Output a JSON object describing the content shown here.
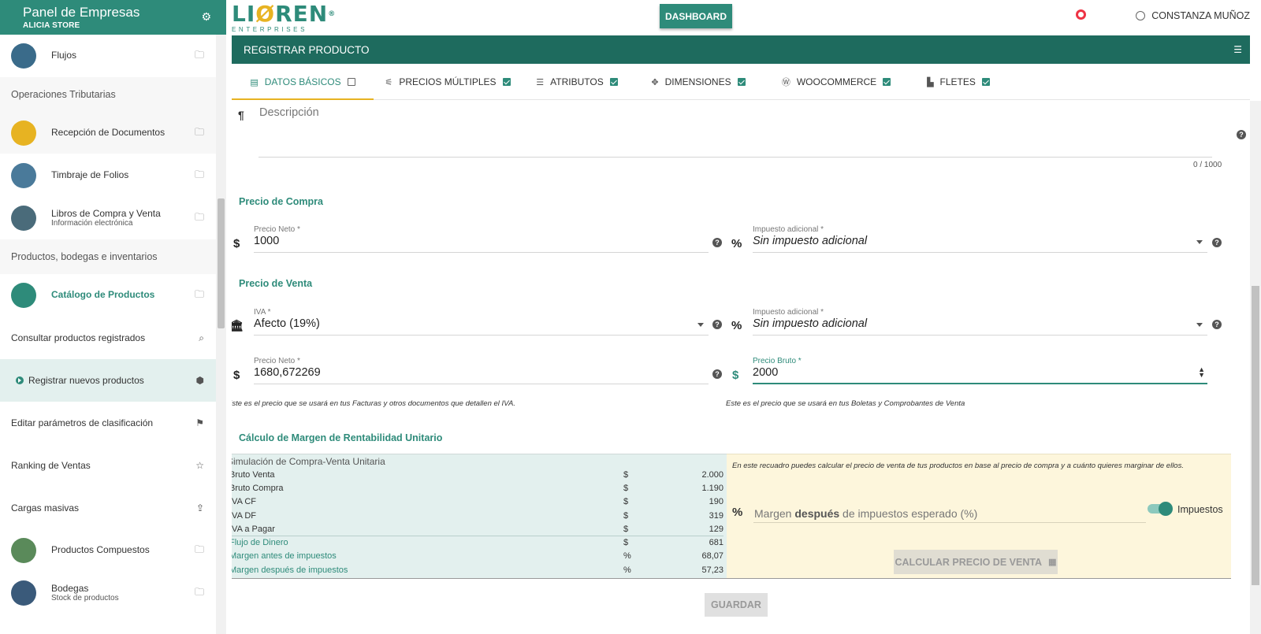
{
  "sidebar": {
    "title": "Panel de Empresas",
    "store": "ALICIA STORE",
    "items": [
      {
        "type": "item",
        "label": "Flujos",
        "sub": ""
      },
      {
        "type": "section",
        "label": "Operaciones Tributarias"
      },
      {
        "type": "item",
        "label": "Recepción de Documentos",
        "sub": ""
      },
      {
        "type": "item",
        "label": "Timbraje de Folios",
        "sub": ""
      },
      {
        "type": "item",
        "label": "Libros de Compra y Venta",
        "sub": "Información electrónica"
      },
      {
        "type": "section",
        "label": "Productos, bodegas e inventarios"
      },
      {
        "type": "item",
        "label": "Catálogo de Productos",
        "sub": ""
      },
      {
        "type": "plain",
        "label": "Consultar productos registrados"
      },
      {
        "type": "plain",
        "label": "Registrar nuevos productos"
      },
      {
        "type": "plain",
        "label": "Editar parámetros de clasificación"
      },
      {
        "type": "plain",
        "label": "Ranking de Ventas"
      },
      {
        "type": "plain",
        "label": "Cargas masivas"
      },
      {
        "type": "item",
        "label": "Productos Compuestos",
        "sub": ""
      },
      {
        "type": "item",
        "label": "Bodegas",
        "sub": "Stock de productos"
      }
    ]
  },
  "topbar": {
    "logo": "LIOREN",
    "logo_sub": "ENTERPRISES",
    "dashboard_label": "DASHBOARD",
    "user_name": "CONSTANZA MUÑOZ"
  },
  "header": {
    "title": "REGISTRAR PRODUCTO"
  },
  "tabs": [
    {
      "label": "DATOS BÁSICOS",
      "checked": false,
      "icon": "card-icon"
    },
    {
      "label": "PRECIOS MÚLTIPLES",
      "checked": true,
      "icon": "sliders-icon"
    },
    {
      "label": "ATRIBUTOS",
      "checked": true,
      "icon": "list-icon"
    },
    {
      "label": "DIMENSIONES",
      "checked": true,
      "icon": "move-icon"
    },
    {
      "label": "WOOCOMMERCE",
      "checked": true,
      "icon": "wordpress-icon"
    },
    {
      "label": "FLETES",
      "checked": true,
      "icon": "truck-icon"
    }
  ],
  "description": {
    "label": "Descripción",
    "counter": "0 / 1000"
  },
  "compra": {
    "title": "Precio de Compra",
    "neto_label": "Precio Neto *",
    "neto_value": "1000",
    "imp_label": "Impuesto adicional *",
    "imp_value": "Sin impuesto adicional"
  },
  "venta": {
    "title": "Precio de Venta",
    "iva_label": "IVA *",
    "iva_value": "Afecto (19%)",
    "imp_label": "Impuesto adicional *",
    "imp_value": "Sin impuesto adicional",
    "neto_label": "Precio Neto *",
    "neto_value": "1680,672269",
    "bruto_label": "Precio Bruto *",
    "bruto_value": "2000",
    "hint_neto": "Este es el precio que se usará en tus Facturas y otros documentos que detallen el IVA.",
    "hint_bruto": "Este es el precio que se usará en tus Boletas y Comprobantes de Venta"
  },
  "margen": {
    "title": "Cálculo de Margen de Rentabilidad Unitario",
    "sim_title": "Simulación de Compra-Venta Unitaria",
    "rows": [
      {
        "label": "Bruto Venta",
        "unit": "$",
        "value": "2.000"
      },
      {
        "label": "Bruto Compra",
        "unit": "$",
        "value": "1.190"
      },
      {
        "label": "IVA CF",
        "unit": "$",
        "value": "190"
      },
      {
        "label": "IVA DF",
        "unit": "$",
        "value": "319"
      },
      {
        "label": "IVA a Pagar",
        "unit": "$",
        "value": "129"
      }
    ],
    "rows2": [
      {
        "label": "Flujo de Dinero",
        "unit": "$",
        "value": "681"
      },
      {
        "label": "Margen antes de impuestos",
        "unit": "%",
        "value": "68,07"
      },
      {
        "label": "Margen después de impuestos",
        "unit": "%",
        "value": "57,23"
      }
    ],
    "info": "En este recuadro puedes calcular el precio de venta de tus productos en base al precio de compra y a cuánto quieres marginar de ellos.",
    "margin_pre": "Margen ",
    "margin_bold": "después",
    "margin_post": " de impuestos esperado (%)",
    "toggle_label": "Impuestos",
    "calc_label": "CALCULAR PRECIO DE VENTA"
  },
  "save_label": "GUARDAR",
  "colors": {
    "primary": "#2e8b7a",
    "header": "#1e6b5e",
    "accent": "#e7b322"
  }
}
